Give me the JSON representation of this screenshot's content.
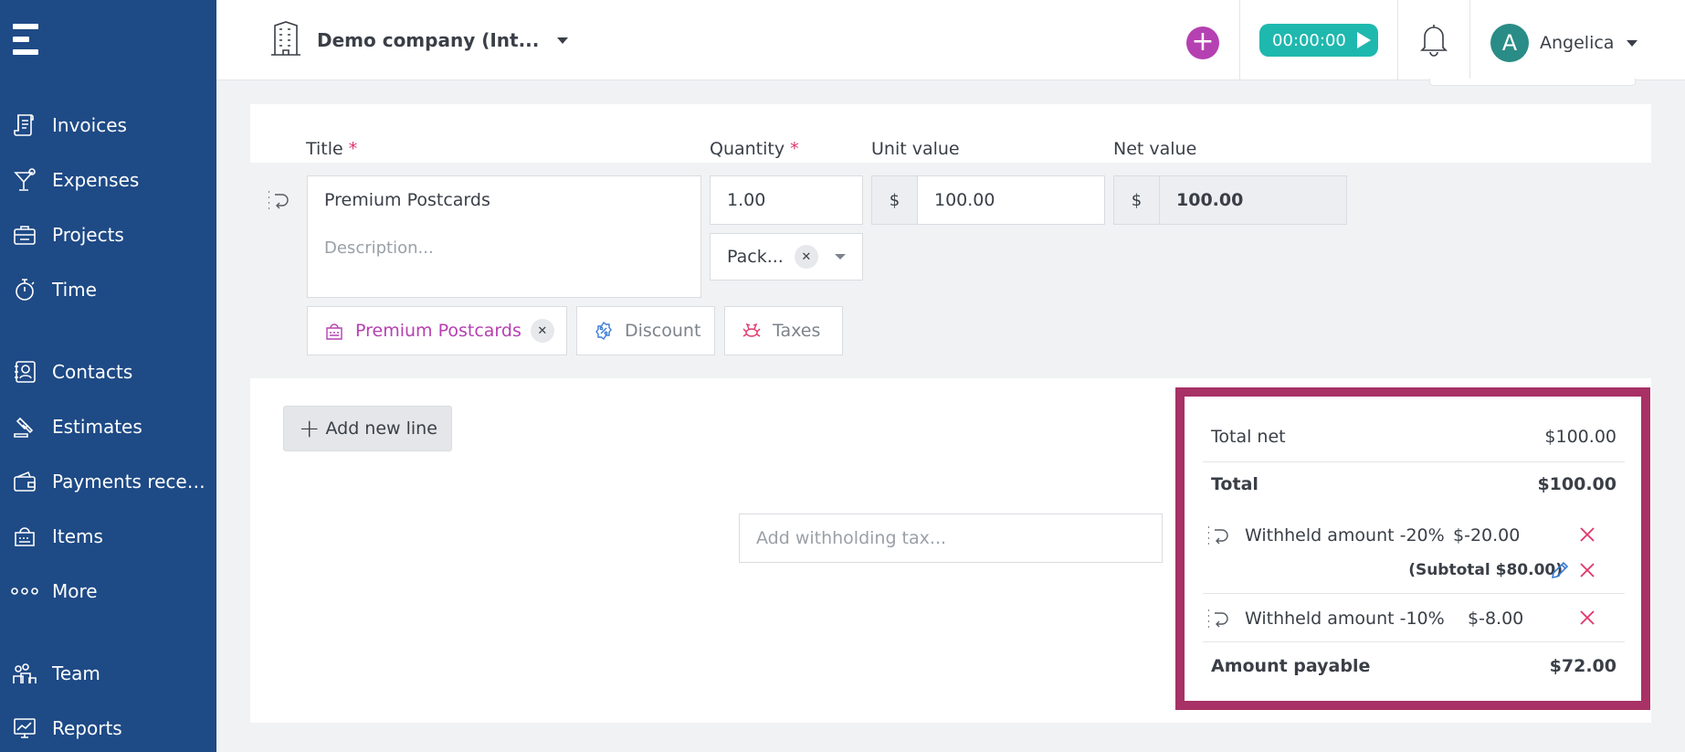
{
  "sidebar": {
    "items": [
      {
        "label": "Invoices",
        "icon": "invoice-icon"
      },
      {
        "label": "Expenses",
        "icon": "cocktail-icon"
      },
      {
        "label": "Projects",
        "icon": "briefcase-icon"
      },
      {
        "label": "Time",
        "icon": "stopwatch-icon"
      },
      {
        "label": "Contacts",
        "icon": "contacts-icon"
      },
      {
        "label": "Estimates",
        "icon": "gavel-icon"
      },
      {
        "label": "Payments recei...",
        "icon": "wallet-icon"
      },
      {
        "label": "Items",
        "icon": "items-icon"
      },
      {
        "label": "More",
        "icon": "more-dots-icon"
      },
      {
        "label": "Team",
        "icon": "team-icon"
      },
      {
        "label": "Reports",
        "icon": "reports-icon"
      }
    ]
  },
  "header": {
    "company": "Demo company (Int...",
    "timer": "00:00:00",
    "user_initial": "A",
    "user_name": "Angelica"
  },
  "line": {
    "labels": {
      "title": "Title",
      "quantity": "Quantity",
      "unit_value": "Unit value",
      "net_value": "Net value",
      "required_mark": "*"
    },
    "title_value": "Premium Postcards",
    "description_placeholder": "Description...",
    "quantity_value": "1.00",
    "unit_currency": "$",
    "unit_value": "100.00",
    "net_currency": "$",
    "net_value": "100.00",
    "unit_type": "Pack...",
    "chips": {
      "item": "Premium Postcards",
      "discount": "Discount",
      "taxes": "Taxes"
    }
  },
  "actions": {
    "add_line": "Add new line",
    "withholding_placeholder": "Add withholding tax..."
  },
  "totals": {
    "net_label": "Total net",
    "net_value": "$100.00",
    "total_label": "Total",
    "total_value": "$100.00",
    "withholdings": [
      {
        "label": "Withheld amount -20%",
        "value": "$-20.00",
        "subtotal": "(Subtotal $80.00)"
      },
      {
        "label": "Withheld amount -10%",
        "value": "$-8.00"
      }
    ],
    "payable_label": "Amount payable",
    "payable_value": "$72.00"
  },
  "colors": {
    "sidebar": "#1e4a86",
    "accent_purple": "#b540b2",
    "timer": "#1fb8ae",
    "highlight_border": "#a83166",
    "delete": "#e0356b"
  }
}
